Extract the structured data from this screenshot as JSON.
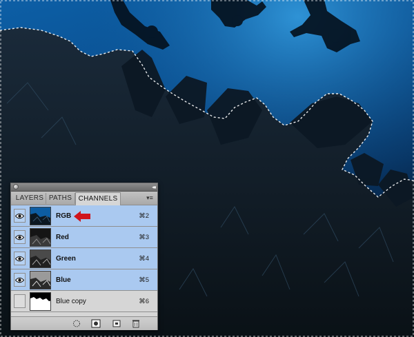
{
  "photo": {
    "description_icons": [
      "diver-icon",
      "coral-reef-scene"
    ]
  },
  "panel": {
    "collapse_glyph": "◂◂",
    "menu_glyph": "▾≡",
    "tabs": [
      {
        "label": "LAYERS",
        "active": false
      },
      {
        "label": "PATHS",
        "active": false
      },
      {
        "label": "CHANNELS",
        "active": true
      }
    ],
    "channels": [
      {
        "name": "RGB",
        "shortcut": "⌘2",
        "visible": true,
        "selected": true,
        "thumb": "rgb"
      },
      {
        "name": "Red",
        "shortcut": "⌘3",
        "visible": true,
        "selected": true,
        "thumb": "red"
      },
      {
        "name": "Green",
        "shortcut": "⌘4",
        "visible": true,
        "selected": true,
        "thumb": "green"
      },
      {
        "name": "Blue",
        "shortcut": "⌘5",
        "visible": true,
        "selected": true,
        "thumb": "blue"
      },
      {
        "name": "Blue copy",
        "shortcut": "⌘6",
        "visible": false,
        "selected": false,
        "thumb": "mask"
      }
    ],
    "bottom_buttons": [
      {
        "icon": "load-selection-icon"
      },
      {
        "icon": "save-selection-icon"
      },
      {
        "icon": "new-channel-icon"
      },
      {
        "icon": "trash-icon"
      }
    ]
  },
  "colors": {
    "selected_row": "#aac9f0",
    "annotation_arrow": "#d0141b",
    "water_top": "#0c5fa8",
    "water_deep": "#05203d"
  }
}
